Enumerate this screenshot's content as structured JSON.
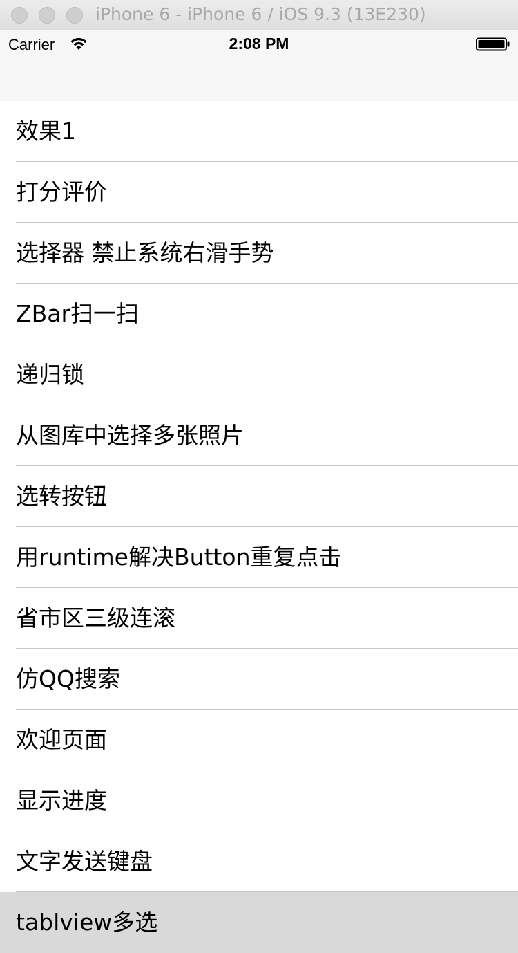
{
  "simulator": {
    "title": "iPhone 6 - iPhone 6 / iOS 9.3 (13E230)"
  },
  "status_bar": {
    "carrier": "Carrier",
    "time": "2:08 PM",
    "wifi_icon": "wifi-icon",
    "battery_icon": "battery-full-icon"
  },
  "table": {
    "rows": [
      {
        "label": "效果1",
        "selected": false
      },
      {
        "label": "打分评价",
        "selected": false
      },
      {
        "label": "选择器 禁止系统右滑手势",
        "selected": false
      },
      {
        "label": "ZBar扫一扫",
        "selected": false
      },
      {
        "label": "递归锁",
        "selected": false
      },
      {
        "label": "从图库中选择多张照片",
        "selected": false
      },
      {
        "label": "选转按钮",
        "selected": false
      },
      {
        "label": "用runtime解决Button重复点击",
        "selected": false
      },
      {
        "label": "省市区三级连滚",
        "selected": false
      },
      {
        "label": "仿QQ搜索",
        "selected": false
      },
      {
        "label": "欢迎页面",
        "selected": false
      },
      {
        "label": "显示进度",
        "selected": false
      },
      {
        "label": "文字发送键盘",
        "selected": false
      },
      {
        "label": "tablview多选",
        "selected": true
      }
    ]
  },
  "colors": {
    "selected_row": "#d9d9d9",
    "separator": "#c8c7cc",
    "nav_bar": "#f7f7f7"
  }
}
